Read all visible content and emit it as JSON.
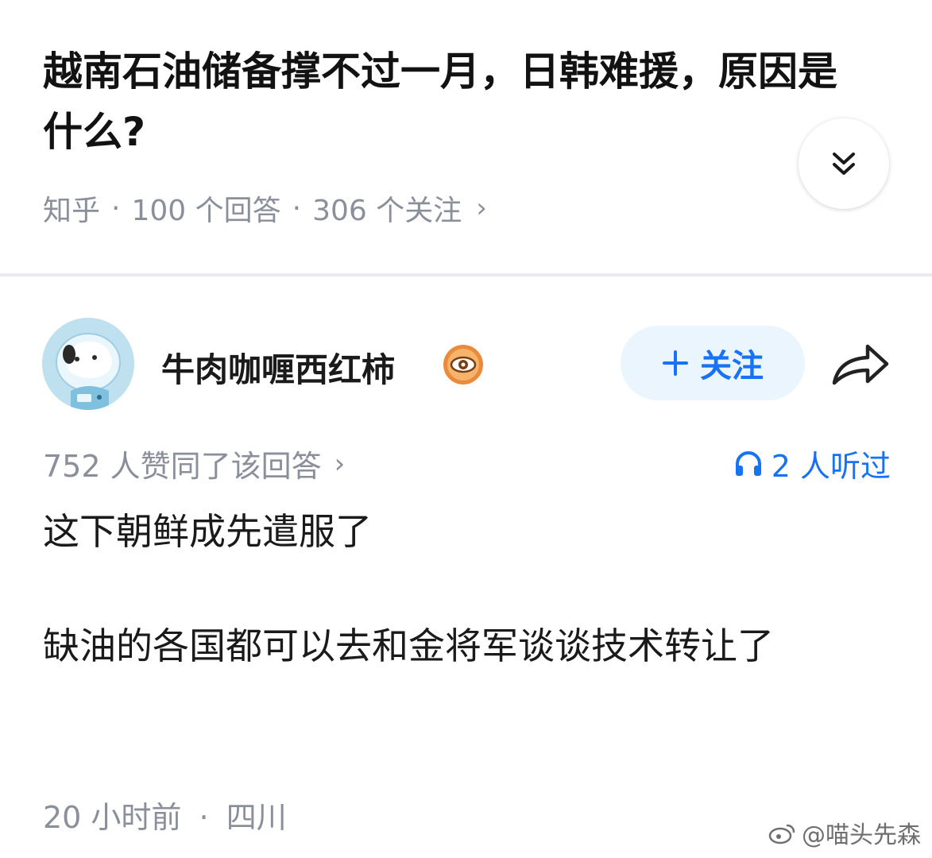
{
  "question": {
    "title": "越南石油储备撑不过一月，日韩难援，原因是什么?",
    "source": "知乎",
    "answers": "100 个回答",
    "followers": "306 个关注"
  },
  "answer": {
    "author": "牛肉咖喱西红柿",
    "follow_label": "关注",
    "votes_text": "752 人赞同了该回答",
    "listens_text": "2 人听过",
    "paragraphs": [
      "这下朝鲜成先遣服了",
      "缺油的各国都可以去和金将军谈谈技术转让了"
    ],
    "time": "20 小时前",
    "location": "四川"
  },
  "watermark": "@喵头先森",
  "colors": {
    "accent": "#1772f6",
    "follow_bg": "#ebf5fd",
    "meta_gray": "#8a8f99"
  },
  "icons": [
    "expand-icon",
    "chevron-right-icon",
    "avatar",
    "badge-icon",
    "plus-icon",
    "share-icon",
    "headphones-icon",
    "weibo-icon"
  ]
}
